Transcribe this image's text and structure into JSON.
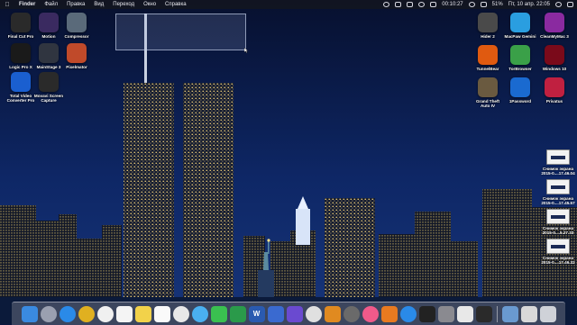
{
  "menubar": {
    "apple_icon": "apple-icon",
    "app_name": "Finder",
    "menus": [
      "Файл",
      "Правка",
      "Вид",
      "Переход",
      "Окно",
      "Справка"
    ],
    "status": {
      "battery": "51%",
      "timer": "00:10:27",
      "datetime": "Пт, 10 апр.  22:05"
    }
  },
  "desktop_left": [
    {
      "label": "Final Cut Pro",
      "icon": "final-cut-pro-icon",
      "color": "#2a2a2a"
    },
    {
      "label": "Motion",
      "icon": "motion-icon",
      "color": "#3a2a60"
    },
    {
      "label": "Compressor",
      "icon": "compressor-icon",
      "color": "#5a6a7a"
    },
    {
      "label": "Logic Pro X",
      "icon": "logic-pro-icon",
      "color": "#1a1a1a"
    },
    {
      "label": "MainStage 3",
      "icon": "mainstage-icon",
      "color": "#303540"
    },
    {
      "label": "Pixelmator",
      "icon": "pixelmator-icon",
      "color": "#c04a2a"
    },
    {
      "label": "Total Video",
      "label2": "Converter Pro",
      "icon": "video-converter-icon",
      "color": "#1a5fd0"
    },
    {
      "label": "Movavi Screen",
      "label2": "Capture",
      "icon": "movavi-capture-icon",
      "color": "#2a2a2a"
    }
  ],
  "desktop_right": [
    {
      "label": "Hider 2",
      "icon": "hider-icon",
      "color": "#4a4a4a"
    },
    {
      "label": "MacPaw Gemini",
      "icon": "gemini-icon",
      "color": "#2a9ee0"
    },
    {
      "label": "CleanMyMac 3",
      "icon": "cleanmymac-icon",
      "color": "#8a2aa0"
    },
    {
      "label": "TunnelBear",
      "icon": "tunnelbear-icon",
      "color": "#e05a10"
    },
    {
      "label": "TorBrowser",
      "icon": "tor-browser-icon",
      "color": "#3aa048"
    },
    {
      "label": "Windows 10",
      "icon": "windows-icon",
      "color": "#7a0a1a"
    },
    {
      "label": "Grand Theft",
      "label2": "Auto IV",
      "icon": "gta-icon",
      "color": "#6a5a40"
    },
    {
      "label": "1Password",
      "icon": "1password-icon",
      "color": "#1a6ad0"
    },
    {
      "label": "Privatus",
      "icon": "privatus-icon",
      "color": "#c02040"
    }
  ],
  "screenshots": [
    {
      "label": "Снимок экрана",
      "label2": "2015-0....17.46.04"
    },
    {
      "label": "Снимок экрана",
      "label2": "2015-0....17.45.57"
    },
    {
      "label": "Снимок экрана",
      "label2": "2015-0....5.27.33"
    },
    {
      "label": "Снимок экрана",
      "label2": "2015-0....17.46.32"
    }
  ],
  "dock": {
    "apps": [
      {
        "name": "finder-icon",
        "color": "#3a8ae0"
      },
      {
        "name": "launchpad-icon",
        "color": "#9aa0b0",
        "circle": true
      },
      {
        "name": "safari-icon",
        "color": "#2a8ae8",
        "circle": true
      },
      {
        "name": "chrome-icon",
        "color": "#e0b020",
        "circle": true
      },
      {
        "name": "clock-icon",
        "color": "#f0f0f0",
        "circle": true
      },
      {
        "name": "calendar-icon",
        "color": "#f4f4f4"
      },
      {
        "name": "notes-icon",
        "color": "#f2d24a"
      },
      {
        "name": "reminders-icon",
        "color": "#fafafa"
      },
      {
        "name": "photos-icon",
        "color": "#e8e8e8",
        "circle": true
      },
      {
        "name": "messages-icon",
        "color": "#4ab0f0",
        "circle": true
      },
      {
        "name": "facetime-icon",
        "color": "#3ac050"
      },
      {
        "name": "sheets-icon",
        "color": "#2a9a4a"
      },
      {
        "name": "word-icon",
        "color": "#2a5ab0",
        "glyph": "W"
      },
      {
        "name": "keynote-icon",
        "color": "#3a6ad0"
      },
      {
        "name": "imovie-icon",
        "color": "#6a4ad0"
      },
      {
        "name": "iphoto-icon",
        "color": "#e0e0e0",
        "circle": true
      },
      {
        "name": "garageband-icon",
        "color": "#e08a20"
      },
      {
        "name": "dvd-player-icon",
        "color": "#6a6a6a",
        "circle": true
      },
      {
        "name": "itunes-icon",
        "color": "#f05a8a",
        "circle": true
      },
      {
        "name": "ibooks-icon",
        "color": "#e87a20"
      },
      {
        "name": "app-store-icon",
        "color": "#2a8ae8",
        "circle": true
      },
      {
        "name": "terminal-icon",
        "color": "#222222"
      },
      {
        "name": "system-preferences-icon",
        "color": "#8a8a90"
      },
      {
        "name": "preview-icon",
        "color": "#e8e8e8"
      },
      {
        "name": "activity-monitor-icon",
        "color": "#2a2a2a"
      }
    ],
    "tail": [
      {
        "name": "downloads-stack-icon",
        "color": "#6a9ad0"
      },
      {
        "name": "documents-stack-icon",
        "color": "#d8d8d8"
      },
      {
        "name": "trash-icon",
        "color": "#cfd2d8"
      }
    ]
  }
}
